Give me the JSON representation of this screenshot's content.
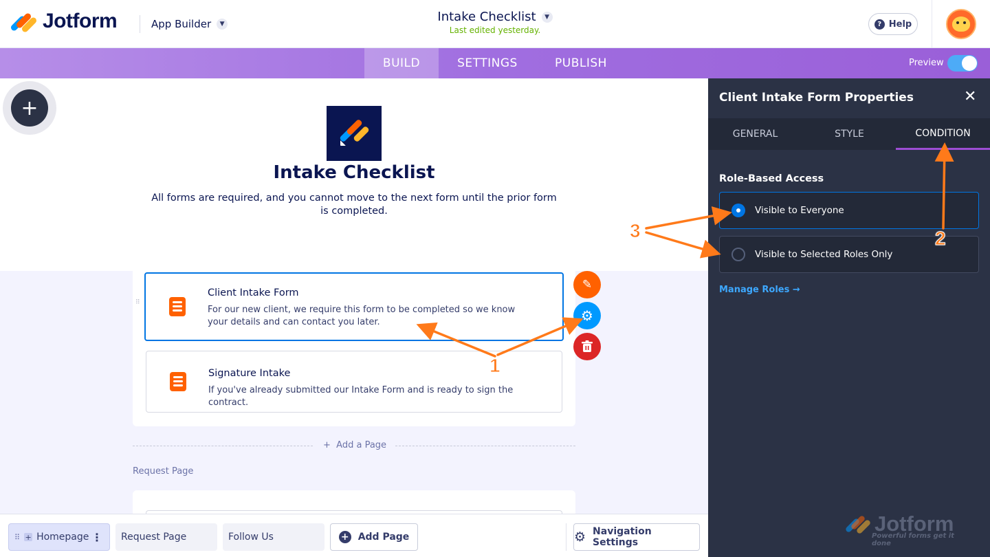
{
  "header": {
    "brand": "Jotform",
    "app_builder": "App Builder",
    "doc_title": "Intake Checklist",
    "last_edited": "Last edited yesterday.",
    "help": "Help",
    "avatar_icon": "user-avatar-icon"
  },
  "nav": {
    "tabs": [
      "BUILD",
      "SETTINGS",
      "PUBLISH"
    ],
    "active_tab": "BUILD",
    "preview_label": "Preview",
    "preview_on": true
  },
  "app": {
    "title": "Intake Checklist",
    "description": "All forms are required, and you cannot move to the next form until the prior form is completed."
  },
  "forms": [
    {
      "title": "Client Intake Form",
      "description": "For our new client, we require this form to be completed so we know your details and can contact you later.",
      "selected": true
    },
    {
      "title": "Signature Intake",
      "description": "If you've already submitted our Intake Form and is ready to sign the contract.",
      "selected": false
    }
  ],
  "add_page": "Add a Page",
  "request_page_label": "Request Page",
  "bottom_bar": {
    "tabs": [
      "Homepage",
      "Request Page",
      "Follow Us"
    ],
    "add_page": "Add Page",
    "navigation_settings": "Navigation Settings"
  },
  "properties_panel": {
    "title": "Client Intake Form Properties",
    "tabs": [
      "GENERAL",
      "STYLE",
      "CONDITION"
    ],
    "active_tab": "CONDITION",
    "section": "Role-Based Access",
    "options": [
      {
        "label": "Visible to Everyone",
        "checked": true
      },
      {
        "label": "Visible to Selected Roles Only",
        "checked": false
      }
    ],
    "manage_roles": "Manage Roles →",
    "watermark": "Jotform",
    "watermark_tagline": "Powerful forms get it done"
  },
  "annotations": [
    "1",
    "2",
    "3"
  ],
  "colors": {
    "accent_purple": "#9c4dd3",
    "brand_navy": "#0a1551",
    "form_icon_orange": "#ff6100",
    "selected_blue": "#0075e3",
    "edit_orange": "#ff6100",
    "settings_blue": "#0099ff",
    "delete_red": "#dc2626",
    "annotation_orange": "#ff7a1a"
  }
}
